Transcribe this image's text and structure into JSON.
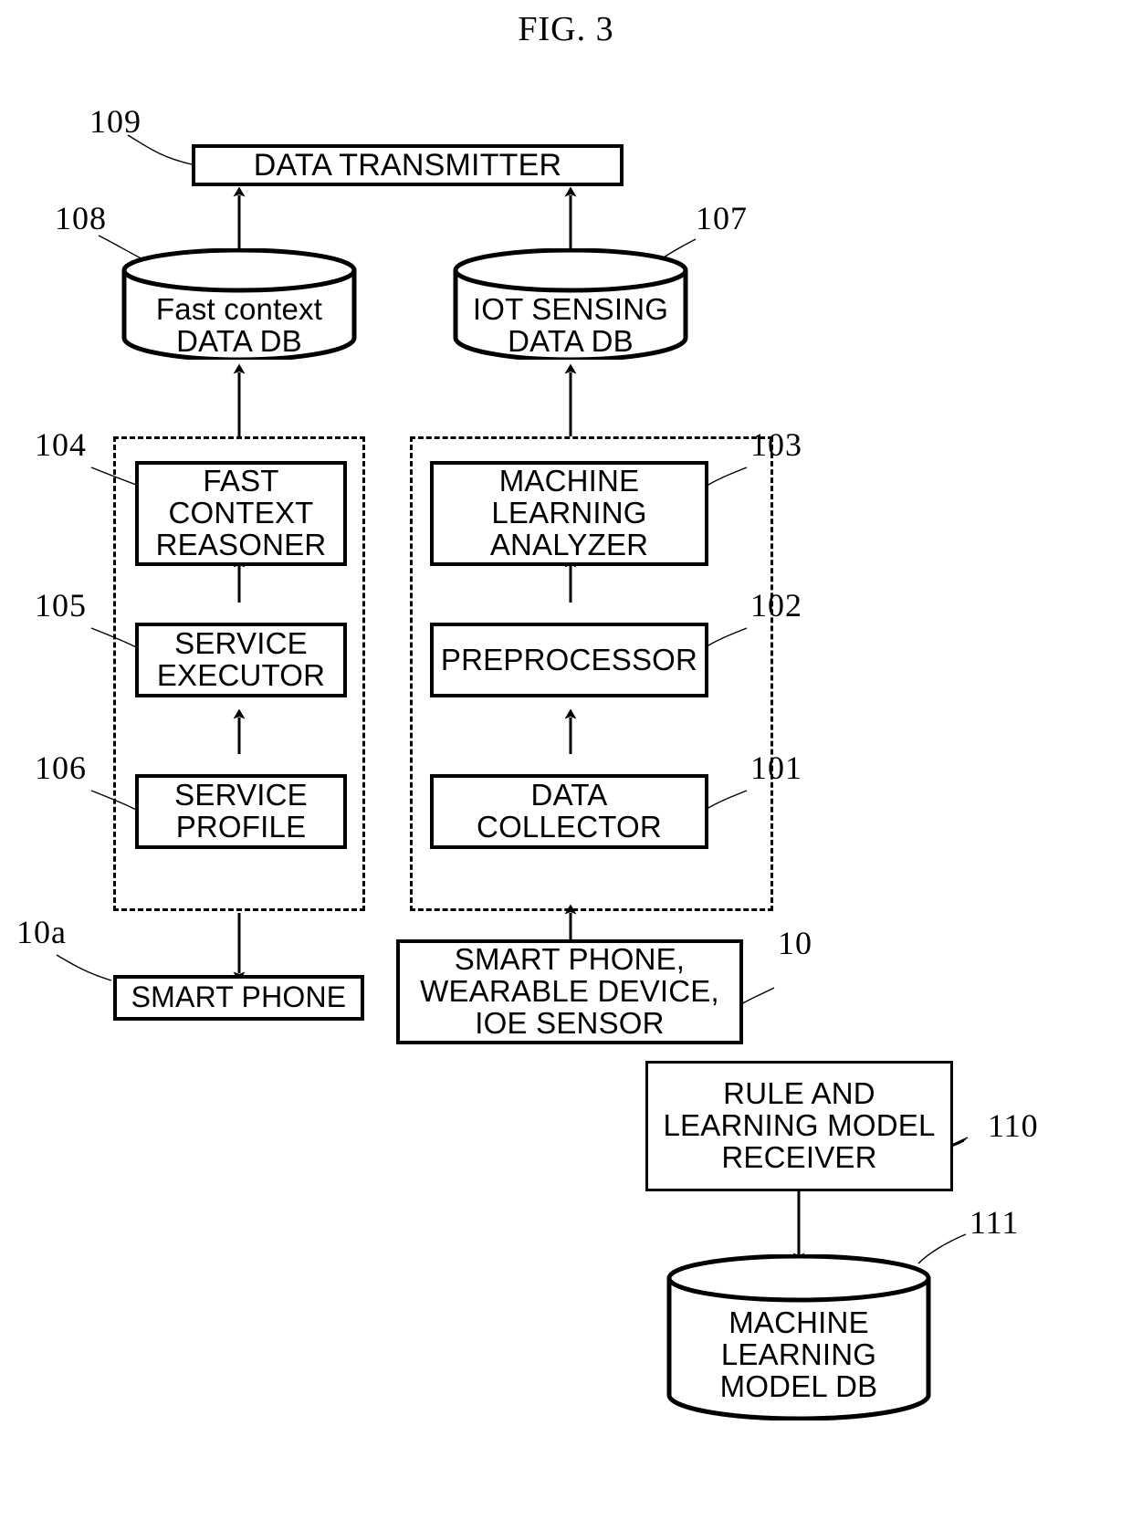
{
  "figure": {
    "title": "FIG. 3"
  },
  "nodes": {
    "data_transmitter": {
      "label": "DATA TRANSMITTER",
      "ref": "109"
    },
    "fast_context_db": {
      "label": "Fast context\nDATA DB",
      "ref": "108"
    },
    "iot_sensing_db": {
      "label": "IOT SENSING\nDATA DB",
      "ref": "107"
    },
    "fast_context_reasoner": {
      "label": "FAST\nCONTEXT\nREASONER",
      "ref": "104"
    },
    "service_executor": {
      "label": "SERVICE\nEXECUTOR",
      "ref": "105"
    },
    "service_profile": {
      "label": "SERVICE\nPROFILE",
      "ref": "106"
    },
    "machine_learning_analyzer": {
      "label": "MACHINE\nLEARNING\nANALYZER",
      "ref": "103"
    },
    "preprocessor": {
      "label": "PREPROCESSOR",
      "ref": "102"
    },
    "data_collector": {
      "label": "DATA\nCOLLECTOR",
      "ref": "101"
    },
    "smart_phone": {
      "label": "SMART PHONE",
      "ref": "10a"
    },
    "smart_phone_wearable_ioe": {
      "label": "SMART PHONE,\nWEARABLE DEVICE,\nIOE SENSOR",
      "ref": "10"
    },
    "rule_and_learning_model_receiver": {
      "label": "RULE AND\nLEARNING MODEL\nRECEIVER",
      "ref": "110"
    },
    "machine_learning_model_db": {
      "label": "MACHINE\nLEARNING\nMODEL DB",
      "ref": "111"
    }
  },
  "colors": {
    "stroke": "#000000",
    "background": "#ffffff"
  }
}
